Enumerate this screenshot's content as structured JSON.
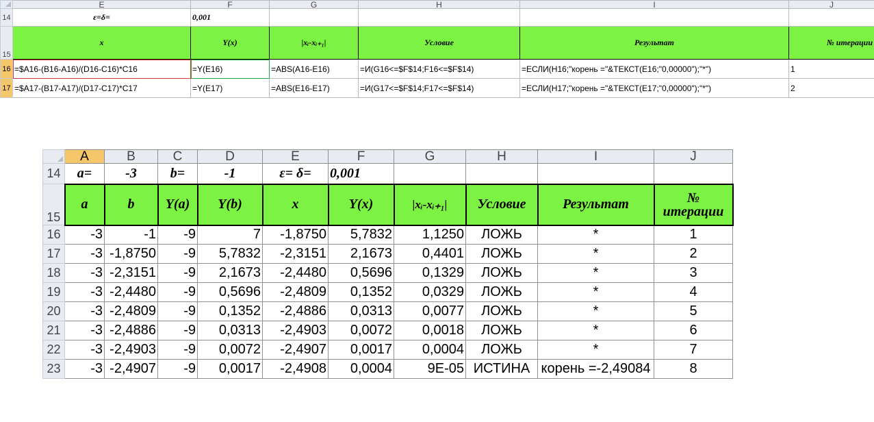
{
  "top": {
    "columns": [
      "E",
      "F",
      "G",
      "H",
      "I",
      "J"
    ],
    "row14": {
      "num": "14",
      "label": "ε=δ=",
      "value": "0,001"
    },
    "header": {
      "num": "15",
      "cells": [
        "x",
        "Y(x)",
        "|xᵢ-xᵢ₊₁|",
        "Условие",
        "Результат",
        "№ итерации"
      ]
    },
    "rows": [
      {
        "num": "16",
        "cells": [
          "=$A16-(B16-A16)/(D16-C16)*C16",
          "=Y(E16)",
          "=ABS(A16-E16)",
          "=И(G16<=$F$14;F16<=$F$14)",
          "=ЕСЛИ(H16;\"корень =\"&ТЕКСТ(E16;\"0,00000\");\"*\")",
          "1"
        ]
      },
      {
        "num": "17",
        "cells": [
          "=$A17-(B17-A17)/(D17-C17)*C17",
          "=Y(E17)",
          "=ABS(E16-E17)",
          "=И(G17<=$F$14;F17<=$F$14)",
          "=ЕСЛИ(H17;\"корень =\"&ТЕКСТ(E17;\"0,00000\");\"*\")",
          "2"
        ]
      }
    ]
  },
  "bottom": {
    "columns": [
      "A",
      "B",
      "C",
      "D",
      "E",
      "F",
      "G",
      "H",
      "I",
      "J"
    ],
    "row14": {
      "num": "14",
      "a_label": "a=",
      "a_value": "-3",
      "b_label": "b=",
      "b_value": "-1",
      "eps_label": "ε= δ=",
      "eps_value": "0,001"
    },
    "header": {
      "num": "15",
      "cells": [
        "a",
        "b",
        "Y(a)",
        "Y(b)",
        "x",
        "Y(x)",
        "|xᵢ-xᵢ₊₁|",
        "Условие",
        "Результат",
        "№ итерации"
      ]
    },
    "rows": [
      {
        "num": "16",
        "cells": [
          "-3",
          "-1",
          "-9",
          "7",
          "-1,8750",
          "5,7832",
          "1,1250",
          "ЛОЖЬ",
          "*",
          "1"
        ]
      },
      {
        "num": "17",
        "cells": [
          "-3",
          "-1,8750",
          "-9",
          "5,7832",
          "-2,3151",
          "2,1673",
          "0,4401",
          "ЛОЖЬ",
          "*",
          "2"
        ]
      },
      {
        "num": "18",
        "cells": [
          "-3",
          "-2,3151",
          "-9",
          "2,1673",
          "-2,4480",
          "0,5696",
          "0,1329",
          "ЛОЖЬ",
          "*",
          "3"
        ]
      },
      {
        "num": "19",
        "cells": [
          "-3",
          "-2,4480",
          "-9",
          "0,5696",
          "-2,4809",
          "0,1352",
          "0,0329",
          "ЛОЖЬ",
          "*",
          "4"
        ]
      },
      {
        "num": "20",
        "cells": [
          "-3",
          "-2,4809",
          "-9",
          "0,1352",
          "-2,4886",
          "0,0313",
          "0,0077",
          "ЛОЖЬ",
          "*",
          "5"
        ]
      },
      {
        "num": "21",
        "cells": [
          "-3",
          "-2,4886",
          "-9",
          "0,0313",
          "-2,4903",
          "0,0072",
          "0,0018",
          "ЛОЖЬ",
          "*",
          "6"
        ]
      },
      {
        "num": "22",
        "cells": [
          "-3",
          "-2,4903",
          "-9",
          "0,0072",
          "-2,4907",
          "0,0017",
          "0,0004",
          "ЛОЖЬ",
          "*",
          "7"
        ]
      },
      {
        "num": "23",
        "cells": [
          "-3",
          "-2,4907",
          "-9",
          "0,0017",
          "-2,4908",
          "0,0004",
          "9E-05",
          "ИСТИНА",
          "корень =-2,49084",
          "8"
        ]
      }
    ]
  },
  "colors": {
    "header_fill": "#7cf342",
    "selected_row_header": "#f5c76a",
    "grid_header": "#e8ecf2"
  }
}
